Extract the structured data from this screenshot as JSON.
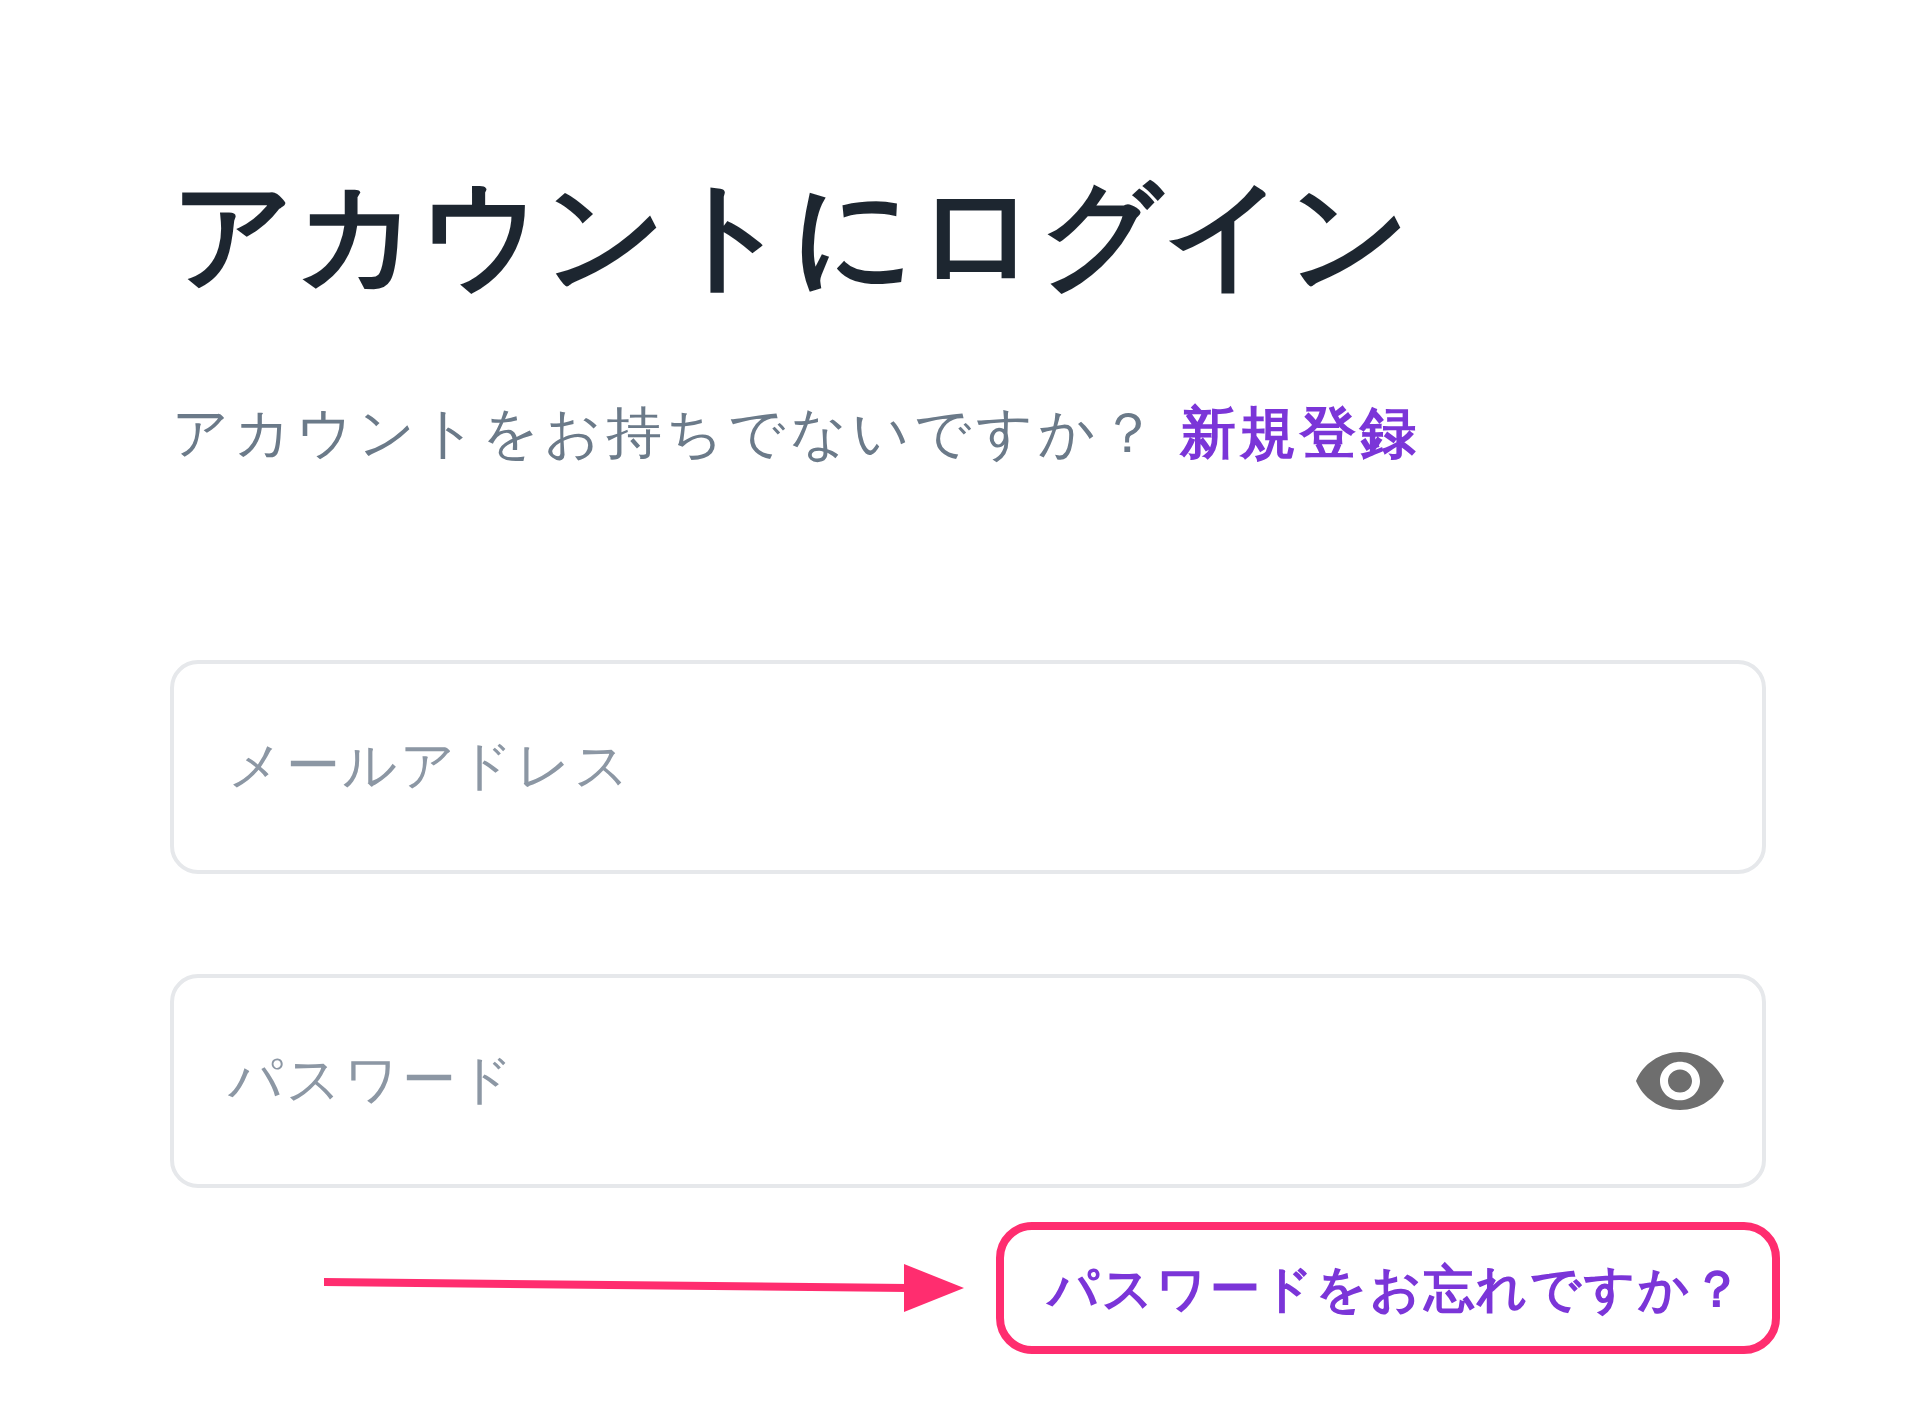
{
  "heading": {
    "title": "アカウントにログイン"
  },
  "signup_prompt": {
    "text": "アカウントをお持ちでないですか？",
    "link": "新規登録"
  },
  "fields": [
    {
      "placeholder": "メールアドレス"
    },
    {
      "placeholder": "パスワード",
      "show_password_toggle": true
    }
  ],
  "forgot_password": {
    "link": "パスワードをお忘れですか？",
    "highlighted": true
  }
}
